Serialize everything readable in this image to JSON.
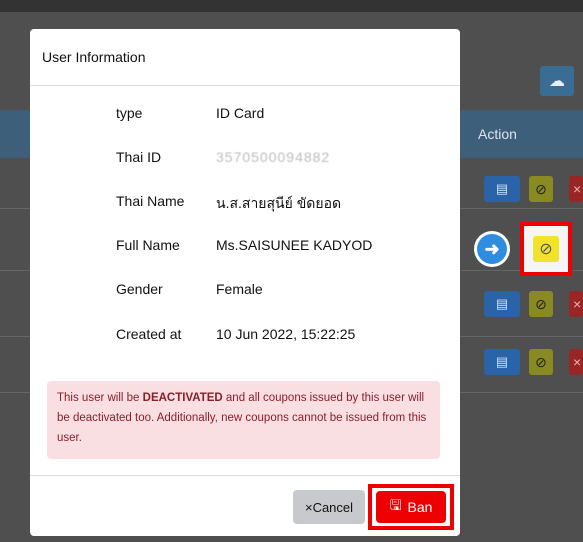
{
  "modal": {
    "title": "User Information",
    "fields": [
      {
        "label": "type",
        "value": "ID Card"
      },
      {
        "label": "Thai ID",
        "value": "3570500094882",
        "masked": true
      },
      {
        "label": "Thai Name",
        "value": "น.ส.สายสุนีย์ ขัดยอด"
      },
      {
        "label": "Full Name",
        "value": "Ms.SAISUNEE KADYOD"
      },
      {
        "label": "Gender",
        "value": "Female"
      },
      {
        "label": "Created at",
        "value": "10 Jun 2022, 15:22:25"
      }
    ],
    "alert": {
      "before": "This user will be ",
      "emphasis": "DEACTIVATED",
      "after": " and all coupons issued by this user will be deactivated too. Additionally, new coupons cannot be issued from this user."
    },
    "cancel_label": "Cancel",
    "cancel_icon": "×",
    "ban_label": "Ban",
    "ban_icon": "🖫"
  },
  "background": {
    "action_header": "Action",
    "upload_icon": "☁",
    "row_icons": {
      "id_card": "▤",
      "ban": "⊘",
      "delete": "×"
    }
  },
  "colors": {
    "danger": "#ee0000",
    "highlight": "#f2e32a",
    "primary": "#2f8de0"
  }
}
